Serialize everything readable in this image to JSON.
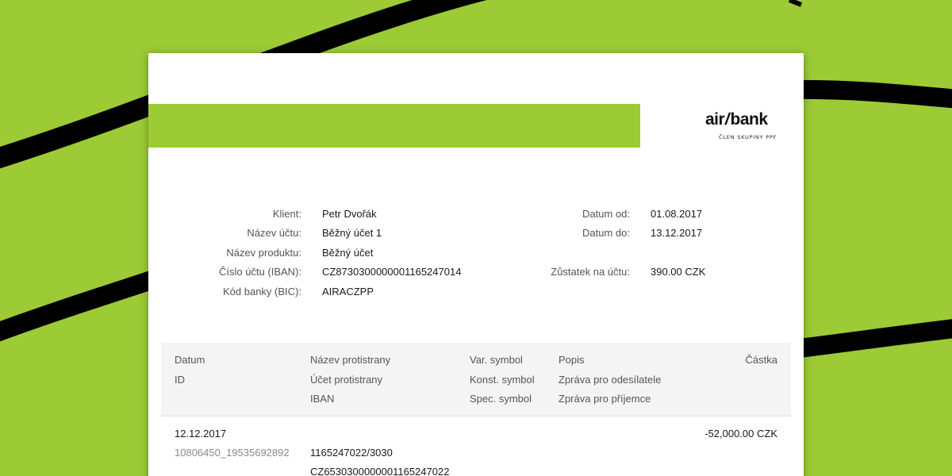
{
  "theme": {
    "brand_green": "#9ccb36",
    "stripe_color": "#000000",
    "paper": "#ffffff"
  },
  "logo": {
    "main_left": "air",
    "main_right": "bank",
    "tagline": "ČLEN SKUPINY PPF"
  },
  "account_info": {
    "left": [
      {
        "label": "Klient:",
        "value": "Petr Dvořák"
      },
      {
        "label": "Název účtu:",
        "value": "Běžný účet 1"
      },
      {
        "label": "Název produktu:",
        "value": "Běžný účet"
      },
      {
        "label": "Číslo účtu (IBAN):",
        "value": "CZ8730300000001165247014"
      },
      {
        "label": "Kód banky (BIC):",
        "value": "AIRACZPP"
      }
    ],
    "right": [
      {
        "label": "Datum od:",
        "value": "01.08.2017"
      },
      {
        "label": "Datum do:",
        "value": "13.12.2017"
      },
      {
        "label": "Zůstatek na účtu:",
        "value": "390.00 CZK"
      }
    ]
  },
  "table": {
    "headers": {
      "col1": [
        "Datum",
        "ID"
      ],
      "col2": [
        "Název protistrany",
        "Účet protistrany",
        "IBAN"
      ],
      "col3": [
        "Var. symbol",
        "Konst. symbol",
        "Spec. symbol"
      ],
      "col4": [
        "Popis",
        "Zpráva pro odesílatele",
        "Zpráva pro příjemce"
      ],
      "col5": [
        "Částka"
      ]
    },
    "rows": [
      {
        "date": "12.12.2017",
        "id": "10806450_19535692892",
        "account": "1165247022/3030",
        "iban": "CZ6530300000001165247022",
        "amount": "-52,000.00 CZK"
      }
    ]
  }
}
